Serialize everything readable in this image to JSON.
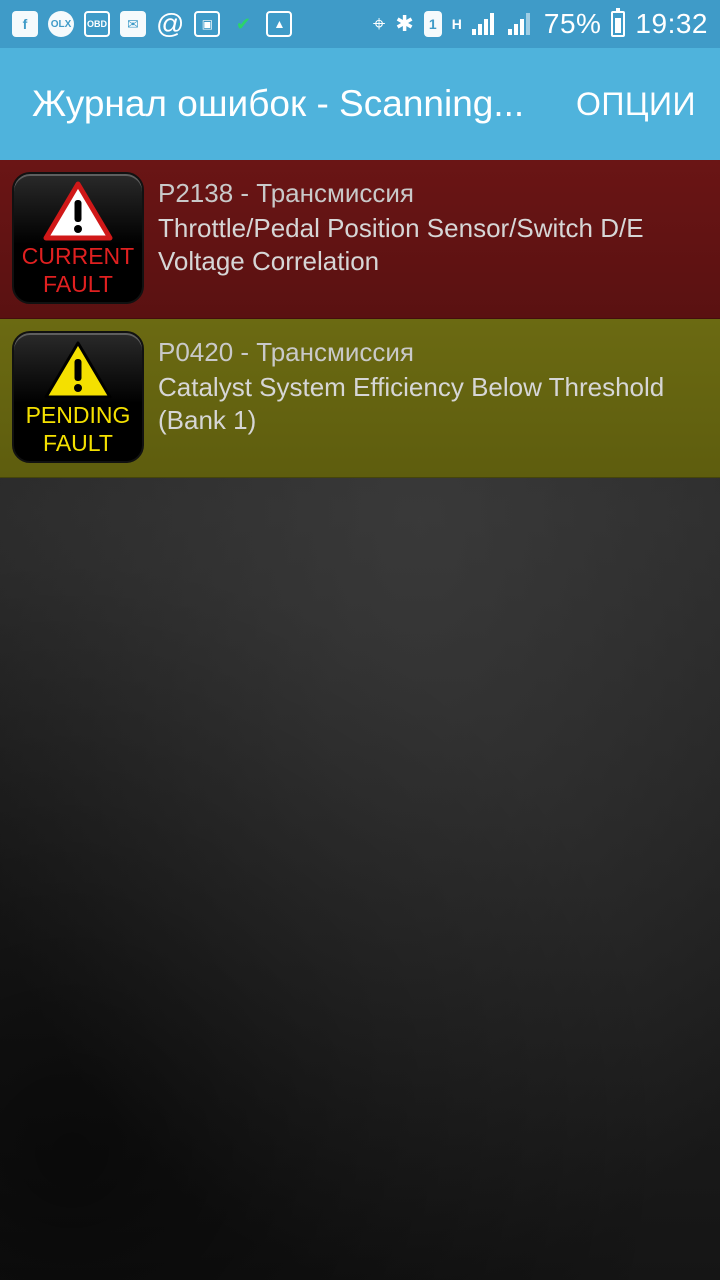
{
  "status_bar": {
    "time": "19:32",
    "battery": "75%",
    "icons": [
      "facebook-icon",
      "olx-icon",
      "obd-icon",
      "mail-icon",
      "at-icon",
      "save-icon",
      "check-icon",
      "image-icon",
      "location-icon",
      "bluetooth-icon",
      "sim-1-icon",
      "hspa-icon",
      "signal-icon",
      "signal-2-icon",
      "battery-icon"
    ],
    "olx_label": "OLX",
    "obd_label": "OBD",
    "sim_label": "1",
    "network_label": "H"
  },
  "app_bar": {
    "title": "Журнал ошибок - Scanning...",
    "options_label": "ОПЦИИ"
  },
  "faults": [
    {
      "type": "current",
      "badge_line1": "CURRENT",
      "badge_line2": "FAULT",
      "code": "P2138 - Трансмиссия",
      "description_line1": "Throttle/Pedal Position Sensor/Switch D/E",
      "description_line2": "Voltage Correlation"
    },
    {
      "type": "pending",
      "badge_line1": "PENDING",
      "badge_line2": "FAULT",
      "code": "P0420 - Трансмиссия",
      "description_line1": "Catalyst System Efficiency Below Threshold",
      "description_line2": "(Bank 1)"
    }
  ],
  "colors": {
    "status_bar": "#3f9bc8",
    "app_bar": "#4fb3dc",
    "current_fault_bg": "#6a1515",
    "pending_fault_bg": "#6b6a12",
    "current_text": "#e02020",
    "pending_text": "#f4e000"
  }
}
